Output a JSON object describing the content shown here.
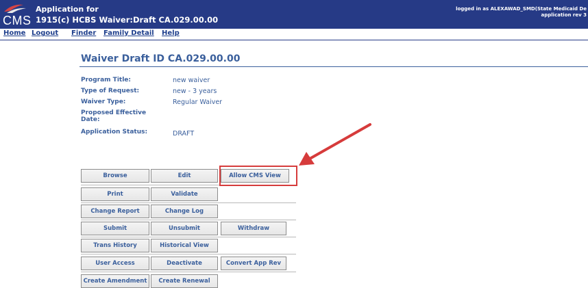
{
  "header": {
    "logo_text": "CMS",
    "title_line1": "Application for",
    "title_line2": "1915(c) HCBS Waiver:Draft CA.029.00.00",
    "login_line1": "logged in as ALEXAWAD_SMD(State Medicaid De",
    "login_line2": "application rev 3"
  },
  "nav": {
    "home": "Home",
    "logout": "Logout",
    "finder": "Finder",
    "family_detail": "Family Detail",
    "help": "Help"
  },
  "page": {
    "title": "Waiver Draft ID CA.029.00.00"
  },
  "info": {
    "program_title_label": "Program Title:",
    "program_title_value": "new waiver",
    "request_type_label": "Type of Request:",
    "request_type_value": "new - 3 years",
    "waiver_type_label": "Waiver Type:",
    "waiver_type_value": "Regular Waiver",
    "effective_date_label_1": "Proposed Effective",
    "effective_date_label_2": "Date:",
    "status_label": "Application Status:",
    "status_value": "DRAFT"
  },
  "actions": {
    "browse": "Browse",
    "edit": "Edit",
    "allow_cms_view": "Allow CMS View",
    "print": "Print",
    "validate": "Validate",
    "change_report": "Change Report",
    "change_log": "Change Log",
    "submit": "Submit",
    "unsubmit": "Unsubmit",
    "withdraw": "Withdraw",
    "trans_history": "Trans History",
    "historical_view": "Historical View",
    "user_access": "User Access",
    "deactivate": "Deactivate",
    "convert_app_rev": "Convert App Rev",
    "create_amendment": "Create Amendment",
    "create_renewal": "Create Renewal"
  },
  "colors": {
    "header_bg": "#263a86",
    "text_blue": "#3a5f9c",
    "highlight_red": "#d63b3b"
  }
}
